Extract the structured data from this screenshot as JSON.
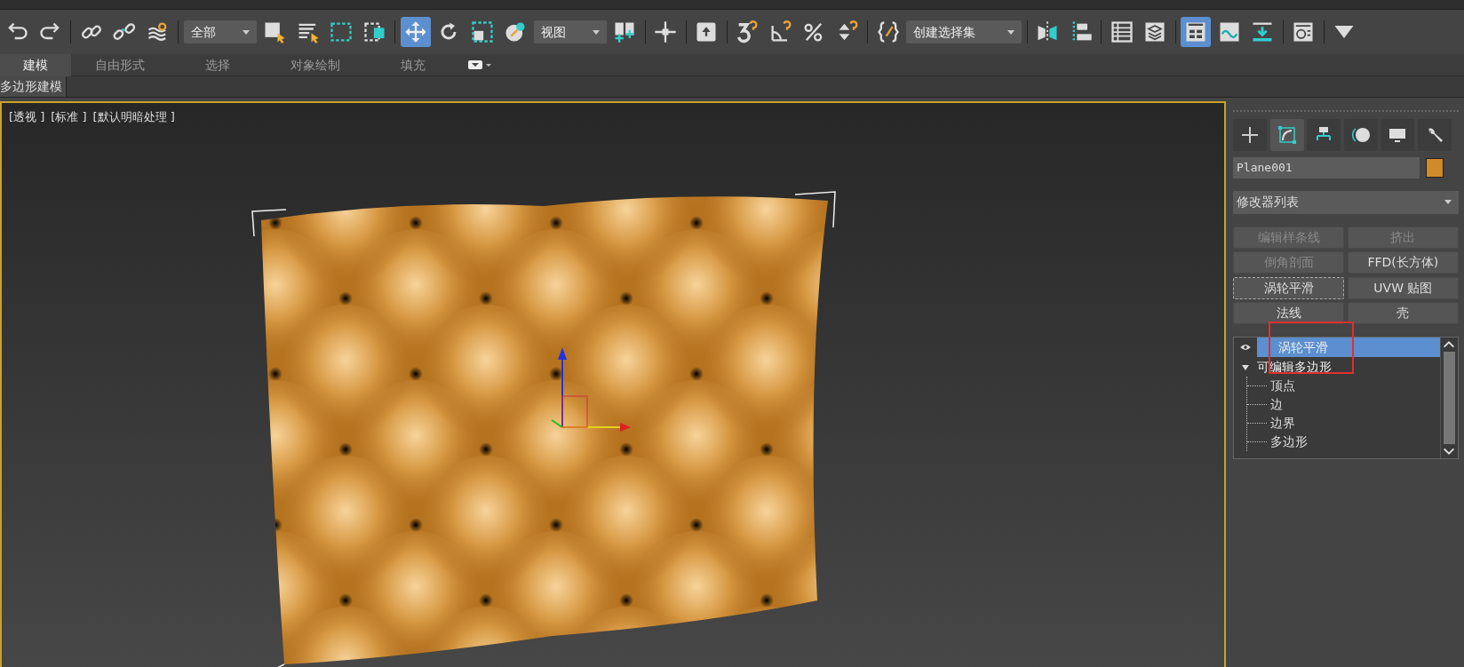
{
  "toolbar": {
    "items": [
      {
        "kind": "icon",
        "selected": false
      },
      {
        "kind": "icon",
        "selected": false
      },
      {
        "kind": "separator"
      },
      {
        "kind": "icon",
        "selected": false
      },
      {
        "kind": "icon",
        "selected": false
      },
      {
        "kind": "icon",
        "selected": false
      },
      {
        "kind": "separator"
      },
      {
        "kind": "dropdown",
        "value": "全部"
      },
      {
        "kind": "icon",
        "selected": false
      },
      {
        "kind": "icon",
        "selected": false
      },
      {
        "kind": "icon",
        "selected": false
      },
      {
        "kind": "icon",
        "selected": false
      },
      {
        "kind": "separator"
      },
      {
        "kind": "icon",
        "selected": true
      },
      {
        "kind": "icon",
        "selected": false
      },
      {
        "kind": "icon",
        "selected": false
      },
      {
        "kind": "icon",
        "selected": false
      },
      {
        "kind": "dropdown",
        "value": "视图"
      },
      {
        "kind": "icon",
        "selected": false
      },
      {
        "kind": "separator"
      },
      {
        "kind": "icon",
        "selected": false
      },
      {
        "kind": "separator"
      },
      {
        "kind": "icon",
        "selected": false
      },
      {
        "kind": "separator"
      },
      {
        "kind": "icon",
        "selected": false
      },
      {
        "kind": "icon",
        "selected": false
      },
      {
        "kind": "icon",
        "selected": false
      },
      {
        "kind": "icon",
        "selected": false
      },
      {
        "kind": "separator"
      },
      {
        "kind": "icon",
        "selected": false
      },
      {
        "kind": "dropdown",
        "value": "创建选择集"
      },
      {
        "kind": "separator"
      },
      {
        "kind": "icon",
        "selected": false
      },
      {
        "kind": "icon",
        "selected": false
      },
      {
        "kind": "separator"
      },
      {
        "kind": "icon",
        "selected": false
      },
      {
        "kind": "icon",
        "selected": false
      },
      {
        "kind": "separator"
      },
      {
        "kind": "icon",
        "selected": true
      },
      {
        "kind": "icon",
        "selected": false
      },
      {
        "kind": "icon",
        "selected": false
      },
      {
        "kind": "separator"
      },
      {
        "kind": "icon",
        "selected": false
      },
      {
        "kind": "separator"
      },
      {
        "kind": "icon",
        "selected": false
      }
    ]
  },
  "ribbon": {
    "tabs": [
      {
        "label": "建模",
        "selected": true
      },
      {
        "label": "自由形式",
        "selected": false
      },
      {
        "label": "选择",
        "selected": false
      },
      {
        "label": "对象绘制",
        "selected": false
      },
      {
        "label": "填充",
        "selected": false
      }
    ],
    "panel_label": "多边形建模"
  },
  "viewport": {
    "labels": [
      "[透视 ]",
      "[标准 ]",
      "[默认明暗处理 ]"
    ]
  },
  "command_panel": {
    "tabs": [
      {
        "selected": false
      },
      {
        "selected": true
      },
      {
        "selected": false
      },
      {
        "selected": false
      },
      {
        "selected": false
      },
      {
        "selected": false
      }
    ],
    "object_name": "Plane001",
    "modifier_list": "修改器列表",
    "modifier_buttons": [
      {
        "label": "编辑样条线",
        "disabled": true,
        "focused": false
      },
      {
        "label": "挤出",
        "disabled": true,
        "focused": false
      },
      {
        "label": "倒角剖面",
        "disabled": true,
        "focused": false
      },
      {
        "label": "FFD(长方体)",
        "disabled": false,
        "focused": false
      },
      {
        "label": "涡轮平滑",
        "disabled": false,
        "focused": true
      },
      {
        "label": "UVW 贴图",
        "disabled": false,
        "focused": false
      },
      {
        "label": "法线",
        "disabled": false,
        "focused": false
      },
      {
        "label": "壳",
        "disabled": false,
        "focused": false
      }
    ],
    "stack": [
      {
        "label": "涡轮平滑",
        "selected": true,
        "eye": true
      },
      {
        "label": "可编辑多边形",
        "selected": false,
        "eye": false,
        "expanded": true,
        "children": [
          {
            "label": "顶点"
          },
          {
            "label": "边"
          },
          {
            "label": "边界"
          },
          {
            "label": "多边形"
          }
        ]
      }
    ]
  }
}
